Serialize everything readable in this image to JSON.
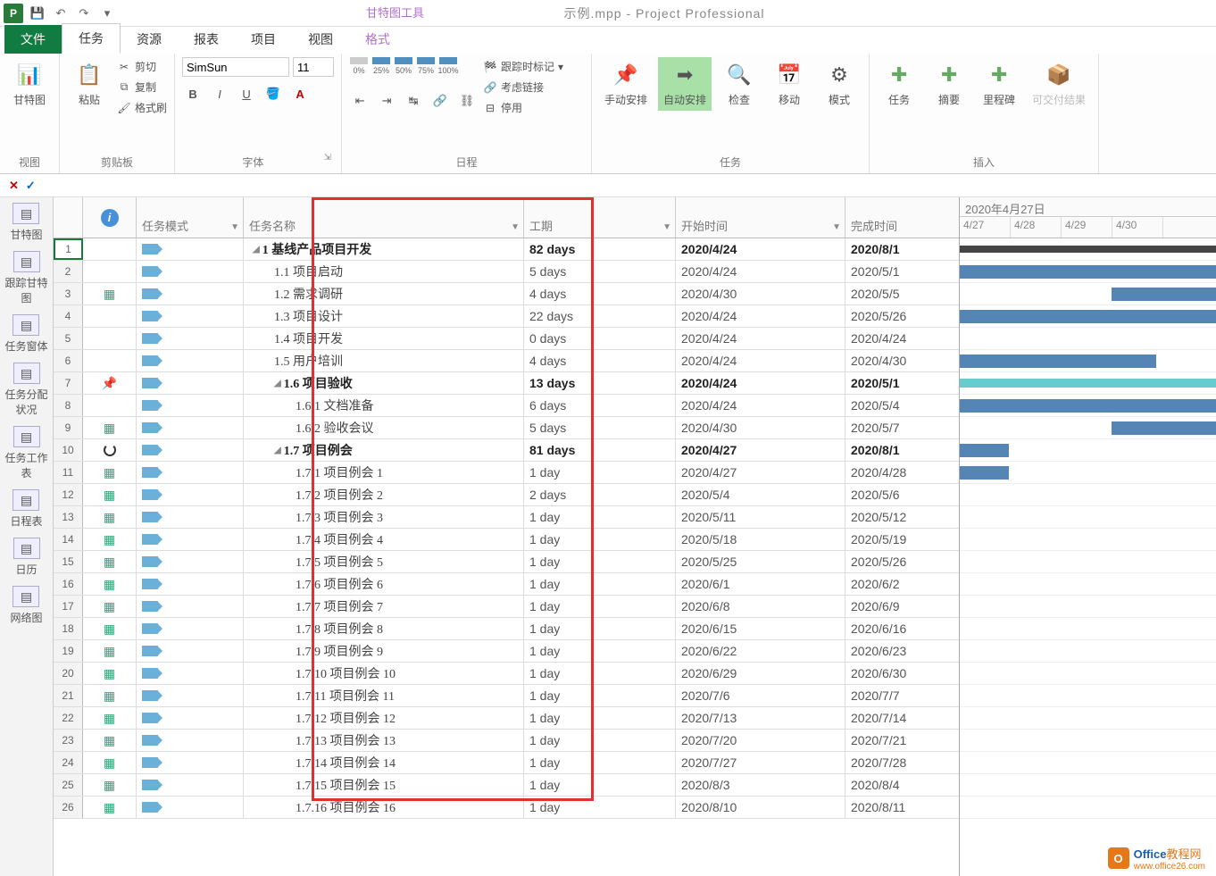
{
  "app": {
    "title": "示例.mpp - Project Professional",
    "tool_tab_title": "甘特图工具"
  },
  "tabs": {
    "file": "文件",
    "task": "任务",
    "resource": "资源",
    "report": "报表",
    "project": "项目",
    "view": "视图",
    "format": "格式"
  },
  "ribbon": {
    "view_group": "视图",
    "gantt_btn": "甘特图",
    "clipboard_group": "剪贴板",
    "paste": "粘贴",
    "cut": "剪切",
    "copy": "复制",
    "format_painter": "格式刷",
    "font_group": "字体",
    "font_name": "SimSun",
    "font_size": "11",
    "schedule_group": "日程",
    "track_mark": "跟踪时标记",
    "respect_links": "考虑链接",
    "deactivate": "停用",
    "pct0": "0%",
    "pct25": "25%",
    "pct50": "50%",
    "pct75": "75%",
    "pct100": "100%",
    "tasks_group": "任务",
    "manual": "手动安排",
    "auto": "自动安排",
    "inspect": "检查",
    "move": "移动",
    "mode": "模式",
    "insert_group": "插入",
    "task_btn": "任务",
    "summary": "摘要",
    "milestone": "里程碑",
    "deliverable": "可交付结果"
  },
  "sidebar": {
    "items": [
      {
        "label": "甘特图"
      },
      {
        "label": "跟踪甘特图"
      },
      {
        "label": "任务窗体"
      },
      {
        "label": "任务分配状况"
      },
      {
        "label": "任务工作表"
      },
      {
        "label": "日程表"
      },
      {
        "label": "日历"
      },
      {
        "label": "网络图"
      }
    ]
  },
  "columns": {
    "info": "ℹ",
    "mode": "任务模式",
    "name": "任务名称",
    "duration": "工期",
    "start": "开始时间",
    "finish": "完成时间"
  },
  "timescale": {
    "month": "2020年4月27日",
    "days": [
      "4/27",
      "4/28",
      "4/29",
      "4/30"
    ]
  },
  "rows": [
    {
      "n": 1,
      "info": "",
      "lvl": 0,
      "sum": true,
      "name": "1 基线产品项目开发",
      "dur": "82 days",
      "start": "2020/4/24",
      "finish": "2020/8/1",
      "bar": [
        0,
        300,
        "summary"
      ]
    },
    {
      "n": 2,
      "info": "",
      "lvl": 1,
      "name": "1.1 项目启动",
      "dur": "5 days",
      "start": "2020/4/24",
      "finish": "2020/5/1",
      "bar": [
        0,
        300,
        "task"
      ]
    },
    {
      "n": 3,
      "info": "cal",
      "lvl": 1,
      "name": "1.2 需求调研",
      "dur": "4 days",
      "start": "2020/4/30",
      "finish": "2020/5/5",
      "bar": [
        170,
        130,
        "task"
      ]
    },
    {
      "n": 4,
      "info": "",
      "lvl": 1,
      "name": "1.3 项目设计",
      "dur": "22 days",
      "start": "2020/4/24",
      "finish": "2020/5/26",
      "bar": [
        0,
        300,
        "task"
      ]
    },
    {
      "n": 5,
      "info": "",
      "lvl": 1,
      "name": "1.4 项目开发",
      "dur": "0 days",
      "start": "2020/4/24",
      "finish": "2020/4/24"
    },
    {
      "n": 6,
      "info": "",
      "lvl": 1,
      "name": "1.5 用户培训",
      "dur": "4 days",
      "start": "2020/4/24",
      "finish": "2020/4/30",
      "bar": [
        0,
        220,
        "task"
      ]
    },
    {
      "n": 7,
      "info": "pin",
      "lvl": 1,
      "sum": true,
      "name": "1.6 项目验收",
      "dur": "13 days",
      "start": "2020/4/24",
      "finish": "2020/5/1",
      "bar": [
        0,
        300,
        "teal"
      ]
    },
    {
      "n": 8,
      "info": "",
      "lvl": 2,
      "name": "1.6.1 文档准备",
      "dur": "6 days",
      "start": "2020/4/24",
      "finish": "2020/5/4",
      "bar": [
        0,
        300,
        "task"
      ]
    },
    {
      "n": 9,
      "info": "cal",
      "lvl": 2,
      "name": "1.6.2 验收会议",
      "dur": "5 days",
      "start": "2020/4/30",
      "finish": "2020/5/7",
      "bar": [
        170,
        130,
        "task"
      ]
    },
    {
      "n": 10,
      "info": "ring",
      "lvl": 1,
      "sum": true,
      "name": "1.7 项目例会",
      "dur": "81 days",
      "start": "2020/4/27",
      "finish": "2020/8/1",
      "bar": [
        0,
        55,
        "task"
      ]
    },
    {
      "n": 11,
      "info": "cal",
      "lvl": 2,
      "name": "1.7.1 项目例会 1",
      "dur": "1 day",
      "start": "2020/4/27",
      "finish": "2020/4/28",
      "bar": [
        0,
        55,
        "task"
      ]
    },
    {
      "n": 12,
      "info": "cal",
      "lvl": 2,
      "name": "1.7.2 项目例会 2",
      "dur": "2 days",
      "start": "2020/5/4",
      "finish": "2020/5/6"
    },
    {
      "n": 13,
      "info": "cal",
      "lvl": 2,
      "name": "1.7.3 项目例会 3",
      "dur": "1 day",
      "start": "2020/5/11",
      "finish": "2020/5/12"
    },
    {
      "n": 14,
      "info": "cal",
      "lvl": 2,
      "name": "1.7.4 项目例会 4",
      "dur": "1 day",
      "start": "2020/5/18",
      "finish": "2020/5/19"
    },
    {
      "n": 15,
      "info": "cal",
      "lvl": 2,
      "name": "1.7.5 项目例会 5",
      "dur": "1 day",
      "start": "2020/5/25",
      "finish": "2020/5/26"
    },
    {
      "n": 16,
      "info": "cal",
      "lvl": 2,
      "name": "1.7.6 项目例会 6",
      "dur": "1 day",
      "start": "2020/6/1",
      "finish": "2020/6/2"
    },
    {
      "n": 17,
      "info": "cal",
      "lvl": 2,
      "name": "1.7.7 项目例会 7",
      "dur": "1 day",
      "start": "2020/6/8",
      "finish": "2020/6/9"
    },
    {
      "n": 18,
      "info": "cal",
      "lvl": 2,
      "name": "1.7.8 项目例会 8",
      "dur": "1 day",
      "start": "2020/6/15",
      "finish": "2020/6/16"
    },
    {
      "n": 19,
      "info": "cal",
      "lvl": 2,
      "name": "1.7.9 项目例会 9",
      "dur": "1 day",
      "start": "2020/6/22",
      "finish": "2020/6/23"
    },
    {
      "n": 20,
      "info": "cal",
      "lvl": 2,
      "name": "1.7.10 项目例会 10",
      "dur": "1 day",
      "start": "2020/6/29",
      "finish": "2020/6/30"
    },
    {
      "n": 21,
      "info": "cal",
      "lvl": 2,
      "name": "1.7.11 项目例会 11",
      "dur": "1 day",
      "start": "2020/7/6",
      "finish": "2020/7/7"
    },
    {
      "n": 22,
      "info": "cal",
      "lvl": 2,
      "name": "1.7.12 项目例会 12",
      "dur": "1 day",
      "start": "2020/7/13",
      "finish": "2020/7/14"
    },
    {
      "n": 23,
      "info": "cal",
      "lvl": 2,
      "name": "1.7.13 项目例会 13",
      "dur": "1 day",
      "start": "2020/7/20",
      "finish": "2020/7/21"
    },
    {
      "n": 24,
      "info": "cal",
      "lvl": 2,
      "name": "1.7.14 项目例会 14",
      "dur": "1 day",
      "start": "2020/7/27",
      "finish": "2020/7/28"
    },
    {
      "n": 25,
      "info": "cal",
      "lvl": 2,
      "name": "1.7.15 项目例会 15",
      "dur": "1 day",
      "start": "2020/8/3",
      "finish": "2020/8/4"
    },
    {
      "n": 26,
      "info": "cal",
      "lvl": 2,
      "name": "1.7.16 项目例会 16",
      "dur": "1 day",
      "start": "2020/8/10",
      "finish": "2020/8/11"
    }
  ],
  "watermark": {
    "brand_a": "Office",
    "brand_b": "教程网",
    "url": "www.office26.com"
  }
}
